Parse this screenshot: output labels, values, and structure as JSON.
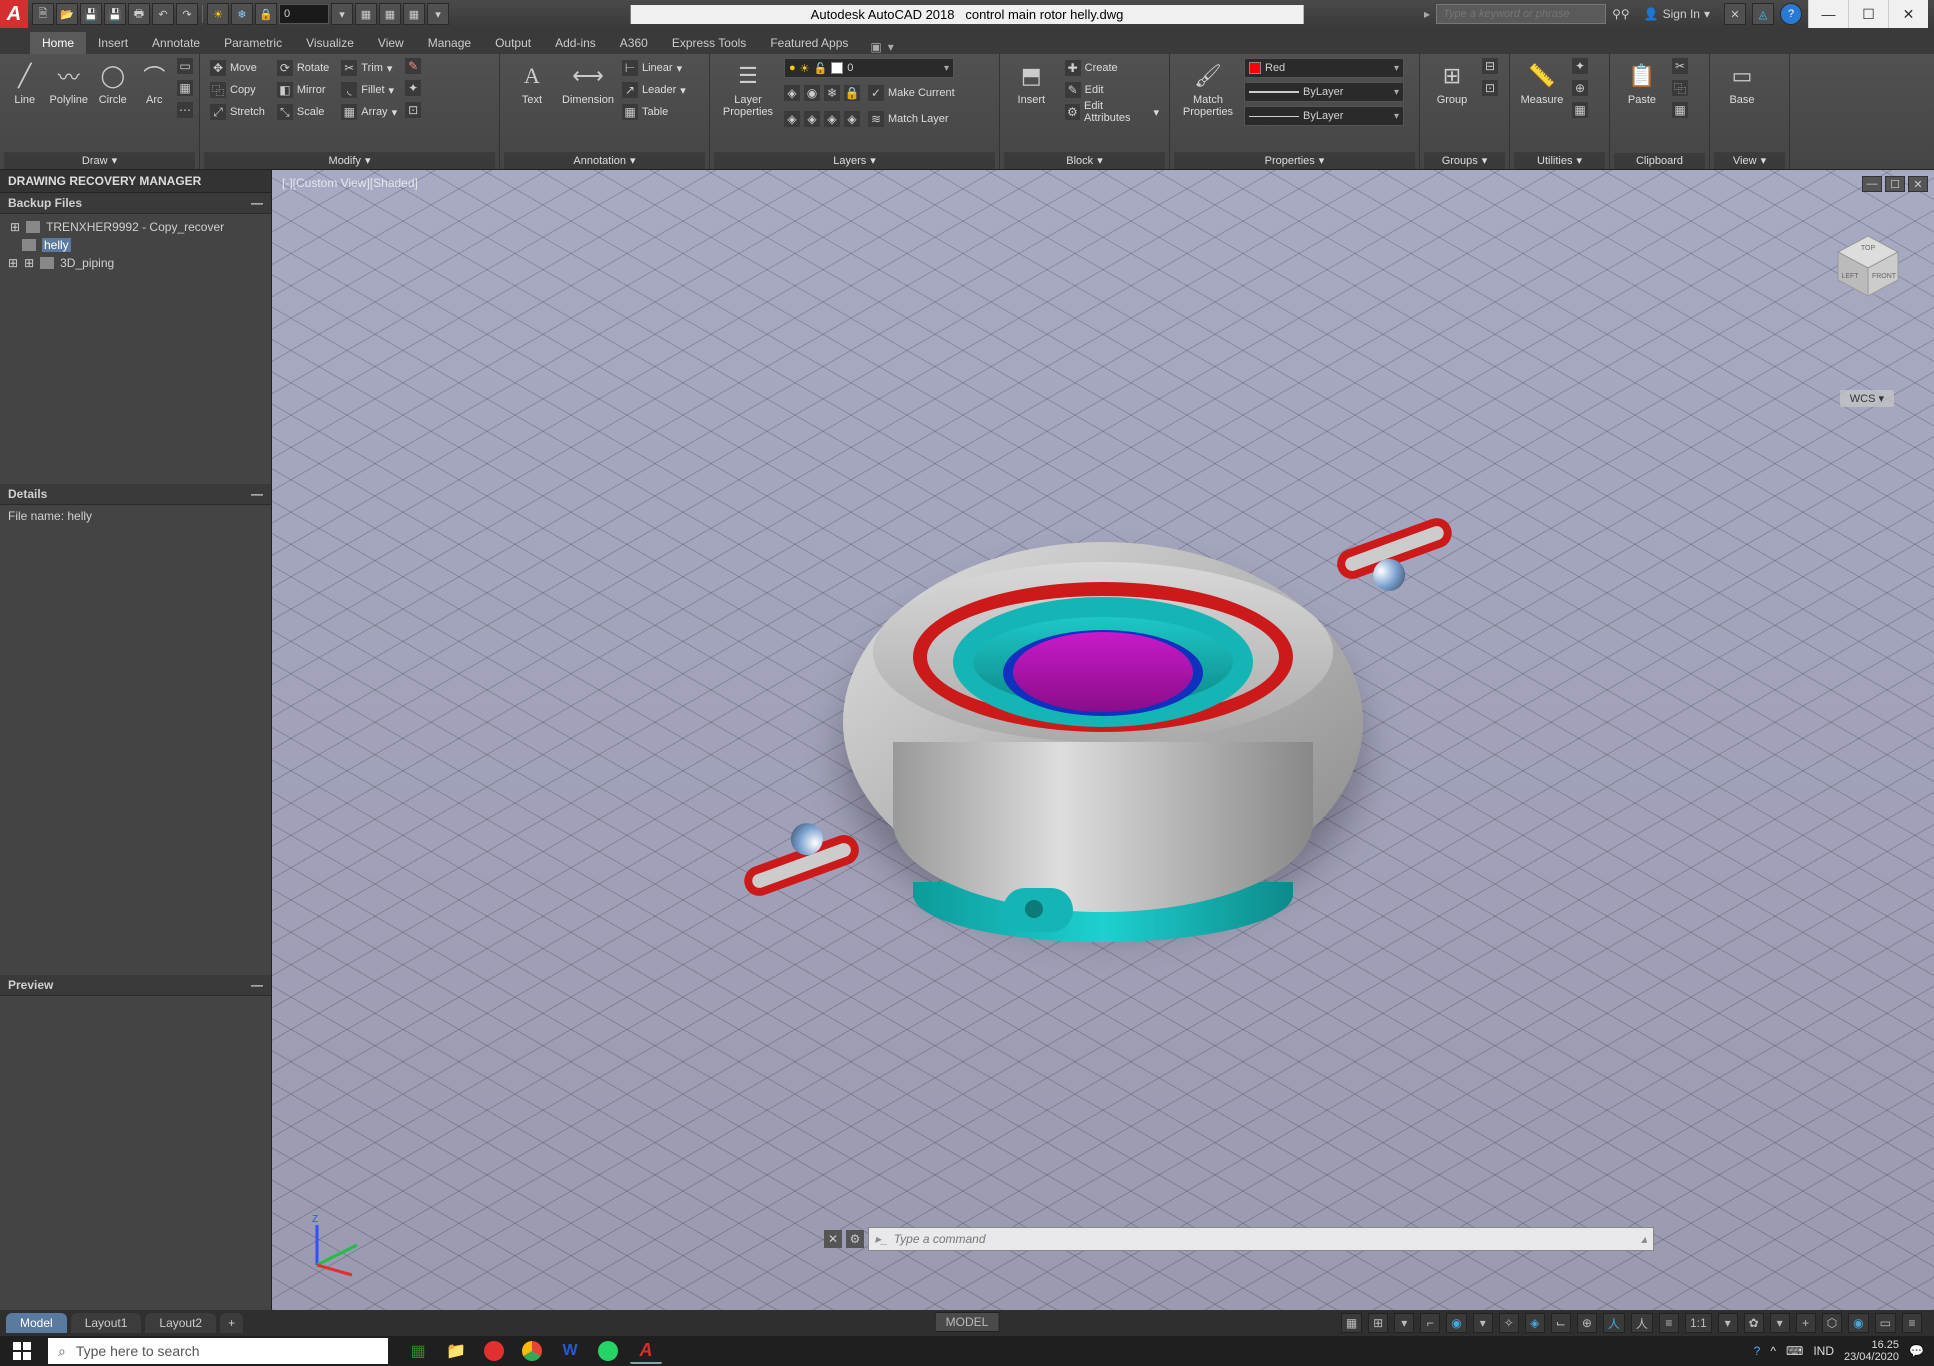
{
  "app": {
    "name": "Autodesk AutoCAD 2018",
    "document": "control main rotor helly.dwg",
    "searchPlaceholder": "Type a keyword or phrase",
    "signIn": "Sign In"
  },
  "qat": {
    "layerValue": "0"
  },
  "tabs": {
    "items": [
      "Home",
      "Insert",
      "Annotate",
      "Parametric",
      "Visualize",
      "View",
      "Manage",
      "Output",
      "Add-ins",
      "A360",
      "Express Tools",
      "Featured Apps"
    ],
    "active": 0
  },
  "ribbon": {
    "draw": {
      "title": "Draw",
      "line": "Line",
      "polyline": "Polyline",
      "circle": "Circle",
      "arc": "Arc"
    },
    "modify": {
      "title": "Modify",
      "move": "Move",
      "rotate": "Rotate",
      "trim": "Trim",
      "copy": "Copy",
      "mirror": "Mirror",
      "fillet": "Fillet",
      "stretch": "Stretch",
      "scale": "Scale",
      "array": "Array"
    },
    "annotation": {
      "title": "Annotation",
      "text": "Text",
      "dimension": "Dimension",
      "linear": "Linear",
      "leader": "Leader",
      "table": "Table"
    },
    "layers": {
      "title": "Layers",
      "props": "Layer Properties",
      "current": "0",
      "makeCurrent": "Make Current",
      "matchLayer": "Match Layer"
    },
    "block": {
      "title": "Block",
      "insert": "Insert",
      "create": "Create",
      "edit": "Edit",
      "editAttr": "Edit Attributes"
    },
    "properties": {
      "title": "Properties",
      "match": "Match Properties",
      "color": "Red",
      "lw1": "ByLayer",
      "lw2": "ByLayer"
    },
    "groups": {
      "title": "Groups",
      "group": "Group"
    },
    "utilities": {
      "title": "Utilities",
      "measure": "Measure"
    },
    "clipboard": {
      "title": "Clipboard",
      "paste": "Paste"
    },
    "view": {
      "title": "View",
      "base": "Base"
    }
  },
  "recovery": {
    "title": "DRAWING RECOVERY MANAGER",
    "backup": "Backup Files",
    "files": [
      "TRENXHER9992 - Copy_recover",
      "helly",
      "3D_piping"
    ],
    "selected": "helly",
    "details": "Details",
    "fileNameLabel": "File name:",
    "fileName": "helly",
    "preview": "Preview"
  },
  "viewport": {
    "label": "[-][Custom View][Shaded]",
    "wcs": "WCS"
  },
  "command": {
    "placeholder": "Type a command"
  },
  "layoutTabs": {
    "items": [
      "Model",
      "Layout1",
      "Layout2"
    ],
    "active": 0,
    "modelBtn": "MODEL",
    "scale": "1:1"
  },
  "taskbar": {
    "searchPlaceholder": "Type here to search",
    "ime": "IND",
    "time": "16.25",
    "date": "23/04/2020"
  }
}
